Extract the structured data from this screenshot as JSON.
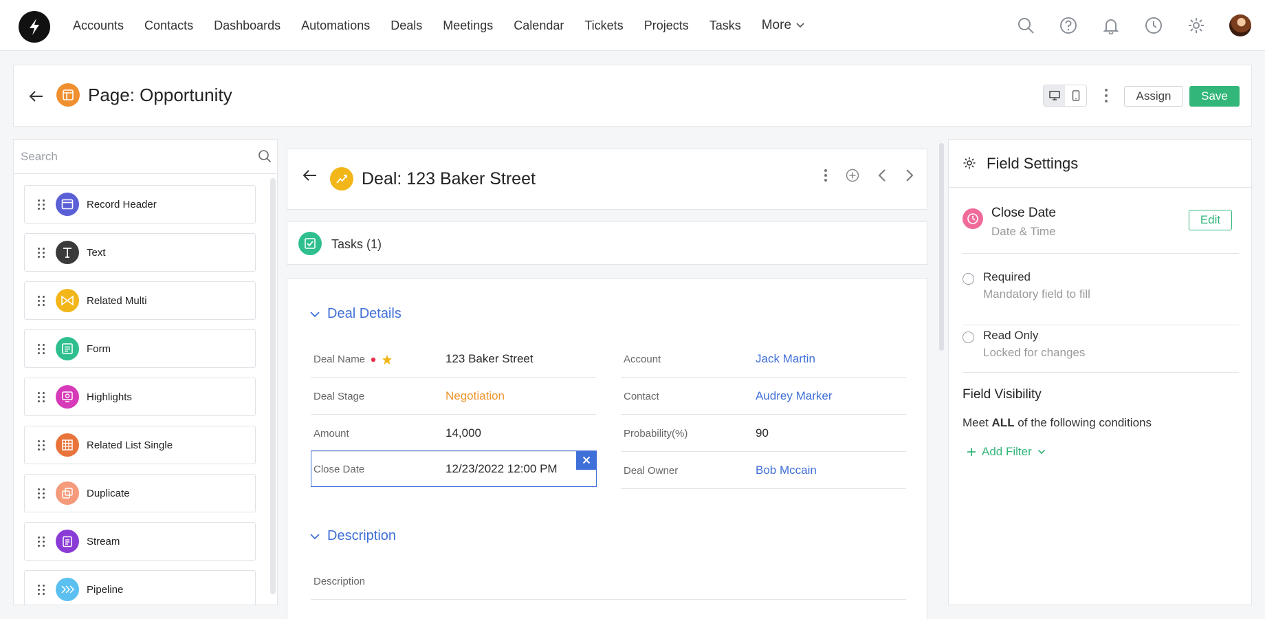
{
  "nav": {
    "items": [
      "Accounts",
      "Contacts",
      "Dashboards",
      "Automations",
      "Deals",
      "Meetings",
      "Calendar",
      "Tickets",
      "Projects",
      "Tasks"
    ],
    "more_label": "More"
  },
  "page": {
    "title": "Page: Opportunity",
    "assign_label": "Assign",
    "save_label": "Save"
  },
  "components": {
    "search_placeholder": "Search",
    "items": [
      {
        "label": "Record Header",
        "color": "#5b5fd6",
        "icon": "record-header-icon"
      },
      {
        "label": "Text",
        "color": "#3a3a3a",
        "icon": "text-icon"
      },
      {
        "label": "Related Multi",
        "color": "#f2b619",
        "icon": "related-multi-icon"
      },
      {
        "label": "Form",
        "color": "#2fbf8f",
        "icon": "form-icon"
      },
      {
        "label": "Highlights",
        "color": "#d63ab8",
        "icon": "highlights-icon"
      },
      {
        "label": "Related List Single",
        "color": "#e8743b",
        "icon": "related-list-icon"
      },
      {
        "label": "Duplicate",
        "color": "#f59a7a",
        "icon": "duplicate-icon"
      },
      {
        "label": "Stream",
        "color": "#8a3bd6",
        "icon": "stream-icon"
      },
      {
        "label": "Pipeline",
        "color": "#5bc0f0",
        "icon": "pipeline-icon"
      }
    ]
  },
  "deal": {
    "title": "Deal: 123 Baker Street",
    "tasks_label": "Tasks (1)",
    "details_label": "Deal Details",
    "description_section": "Description",
    "description_field": "Description",
    "fields": {
      "deal_name": {
        "label": "Deal Name",
        "value": "123 Baker Street"
      },
      "account": {
        "label": "Account",
        "value": "Jack Martin"
      },
      "deal_stage": {
        "label": "Deal Stage",
        "value": "Negotiation"
      },
      "contact": {
        "label": "Contact",
        "value": "Audrey Marker"
      },
      "amount": {
        "label": "Amount",
        "value": "14,000"
      },
      "probability": {
        "label": "Probability(%)",
        "value": "90"
      },
      "close_date": {
        "label": "Close Date",
        "value": "12/23/2022 12:00 PM"
      },
      "deal_owner": {
        "label": "Deal Owner",
        "value": "Bob Mccain"
      }
    }
  },
  "settings": {
    "title": "Field Settings",
    "field_name": "Close Date",
    "field_type": "Date & Time",
    "edit_label": "Edit",
    "required_label": "Required",
    "required_sub": "Mandatory field to fill",
    "readonly_label": "Read Only",
    "readonly_sub": "Locked for changes",
    "visibility_title": "Field Visibility",
    "cond_prefix": "Meet ",
    "cond_bold": "ALL",
    "cond_suffix": " of the following conditions",
    "add_filter_label": "Add Filter"
  },
  "colors": {
    "accent": "#3f6fd8",
    "save": "#33b679",
    "warning": "#f0942c"
  }
}
